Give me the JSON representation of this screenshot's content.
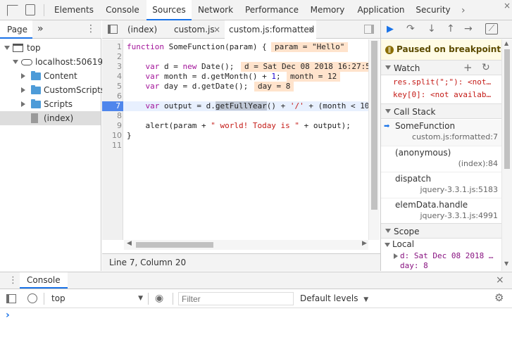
{
  "top_tabs": [
    "Elements",
    "Console",
    "Sources",
    "Network",
    "Performance",
    "Memory",
    "Application",
    "Security"
  ],
  "navigator": {
    "tab_label": "Page",
    "more": "»",
    "tree": {
      "top": "top",
      "host": "localhost:50619",
      "folders": [
        "Content",
        "CustomScripts",
        "Scripts"
      ],
      "file": "(index)"
    }
  },
  "editor": {
    "tabs": [
      "(index)",
      "custom.js",
      "custom.js:formatted"
    ],
    "close_glyph": "×",
    "line_numbers": [
      "1",
      "2",
      "3",
      "4",
      "5",
      "6",
      "7",
      "8",
      "9",
      "10",
      "11"
    ],
    "lines": {
      "l1": {
        "kw": "function",
        "rest": " SomeFunction(param) {"
      },
      "l3": {
        "a": "    ",
        "kw": "var",
        "b": " d = ",
        "kw2": "new",
        "c": " Date();"
      },
      "l4": {
        "a": "    ",
        "kw": "var",
        "b": " month = d.getMonth() + ",
        "num": "1",
        "c": ";"
      },
      "l5": {
        "a": "    ",
        "kw": "var",
        "b": " day = d.getDate();"
      },
      "l7": {
        "a": "    ",
        "kw": "var",
        "b": " output = d.",
        "hl": "getFullYear",
        "c": "() + ",
        "str": "'/'",
        "d": " + (month < 10"
      },
      "l9": {
        "a": "    alert(param + ",
        "str": "\" world! Today is \"",
        "b": " + output);"
      },
      "l10": {
        "rest": "}"
      }
    },
    "inline_values": {
      "param": "param = \"Hello\"",
      "d": "d = Sat Dec 08 2018 16:27:5",
      "month": "month = 12",
      "day": "day = 8"
    },
    "status": "Line 7, Column 20"
  },
  "debugger": {
    "paused_message": "Paused on breakpoint",
    "watch": {
      "title": "Watch",
      "items": [
        "res.split(\";\"): <not…",
        "key[0]: <not availab…"
      ]
    },
    "call_stack": {
      "title": "Call Stack",
      "frames": [
        {
          "name": "SomeFunction",
          "location": "custom.js:formatted:7"
        },
        {
          "name": "(anonymous)",
          "location": "(index):84"
        },
        {
          "name": "dispatch",
          "location": "jquery-3.3.1.js:5183"
        },
        {
          "name": "elemData.handle",
          "location": "jquery-3.3.1.js:4991"
        }
      ]
    },
    "scope": {
      "title": "Scope",
      "local_label": "Local",
      "d_line": "d: Sat Dec 08 2018 …",
      "day_line": "day: 8"
    }
  },
  "console": {
    "tab_label": "Console",
    "context": "top",
    "filter_placeholder": "Filter",
    "levels": "Default levels",
    "prompt": "›"
  },
  "colors": {
    "accent": "#1a73e8",
    "breakpoint": "#4f86ec",
    "inline_bg": "#ffe3cc"
  }
}
